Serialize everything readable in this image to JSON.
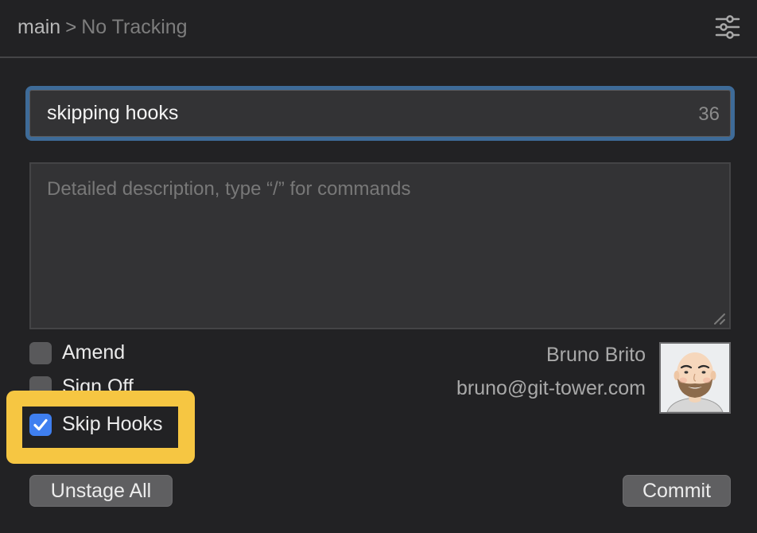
{
  "header": {
    "branch": "main",
    "separator": ">",
    "tracking": "No Tracking",
    "filter_icon": "sliders-icon"
  },
  "summary": {
    "value": "skipping hooks",
    "remaining_chars": "36"
  },
  "description": {
    "value": "",
    "placeholder": "Detailed description, type “/” for commands"
  },
  "options": [
    {
      "label": "Amend",
      "checked": false
    },
    {
      "label": "Sign Off",
      "checked": false
    },
    {
      "label": "Skip Hooks",
      "checked": true
    }
  ],
  "author": {
    "name": "Bruno Brito",
    "email": "bruno@git-tower.com",
    "avatar_icon": "avatar-caricature"
  },
  "actions": {
    "unstage_all": "Unstage All",
    "commit": "Commit"
  },
  "colors": {
    "accent": "#3f7ff0",
    "focus_ring": "#3e6b98",
    "highlight": "#f6c642"
  }
}
